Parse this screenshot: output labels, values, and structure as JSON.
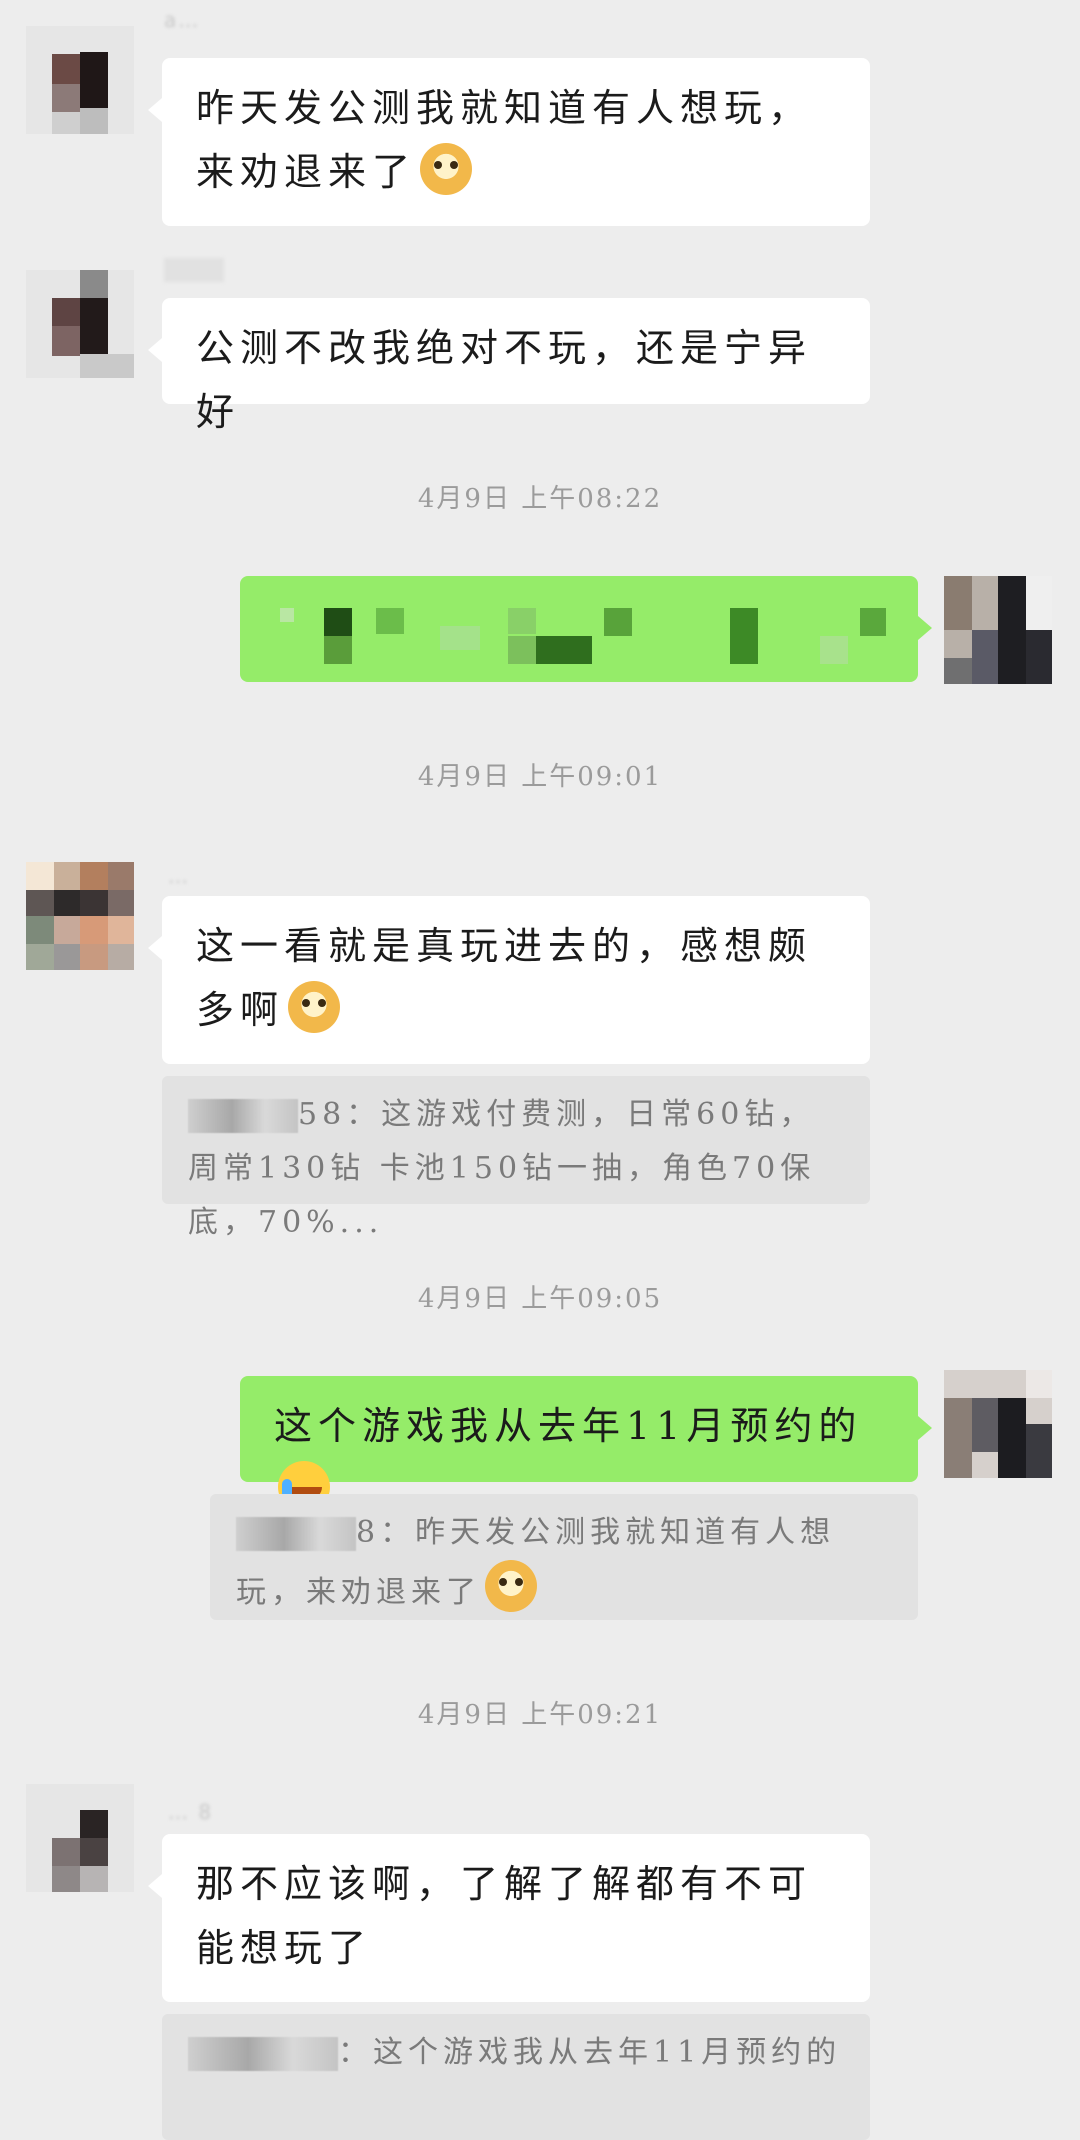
{
  "messages": {
    "m1": {
      "nick": "a…",
      "text": "昨天发公测我就知道有人想玩，来劝退来了",
      "emoji": "doge-icon"
    },
    "m2": {
      "text": "公测不改我绝对不玩，还是宁异好"
    },
    "t1": "4月9日 上午08:22",
    "t2": "4月9日 上午09:01",
    "m4": {
      "nick": "…",
      "text": "这一看就是真玩进去的，感想颇多啊",
      "emoji": "doge-icon"
    },
    "q4": {
      "text": "58：这游戏付费测，日常60钻，周常130钻 卡池150钻一抽，角色70保底，70%..."
    },
    "t3": "4月9日 上午09:05",
    "m5": {
      "text": "这个游戏我从去年11月预约的",
      "emoji": "crying-laughing-icon"
    },
    "q5": {
      "text": "8：昨天发公测我就知道有人想玩，来劝退来了",
      "emoji": "doge-icon"
    },
    "t4": "4月9日 上午09:21",
    "m6": {
      "nick": "… 8",
      "text": "那不应该啊，了解了解都有不可能想玩了"
    },
    "q6": {
      "text": "：这个游戏我从去年11月预约的"
    }
  },
  "colors": {
    "background": "#ededed",
    "incoming_bubble": "#ffffff",
    "outgoing_bubble": "#95ec69",
    "quote_bg": "#e2e2e2",
    "time_text": "#9b9b9b"
  }
}
